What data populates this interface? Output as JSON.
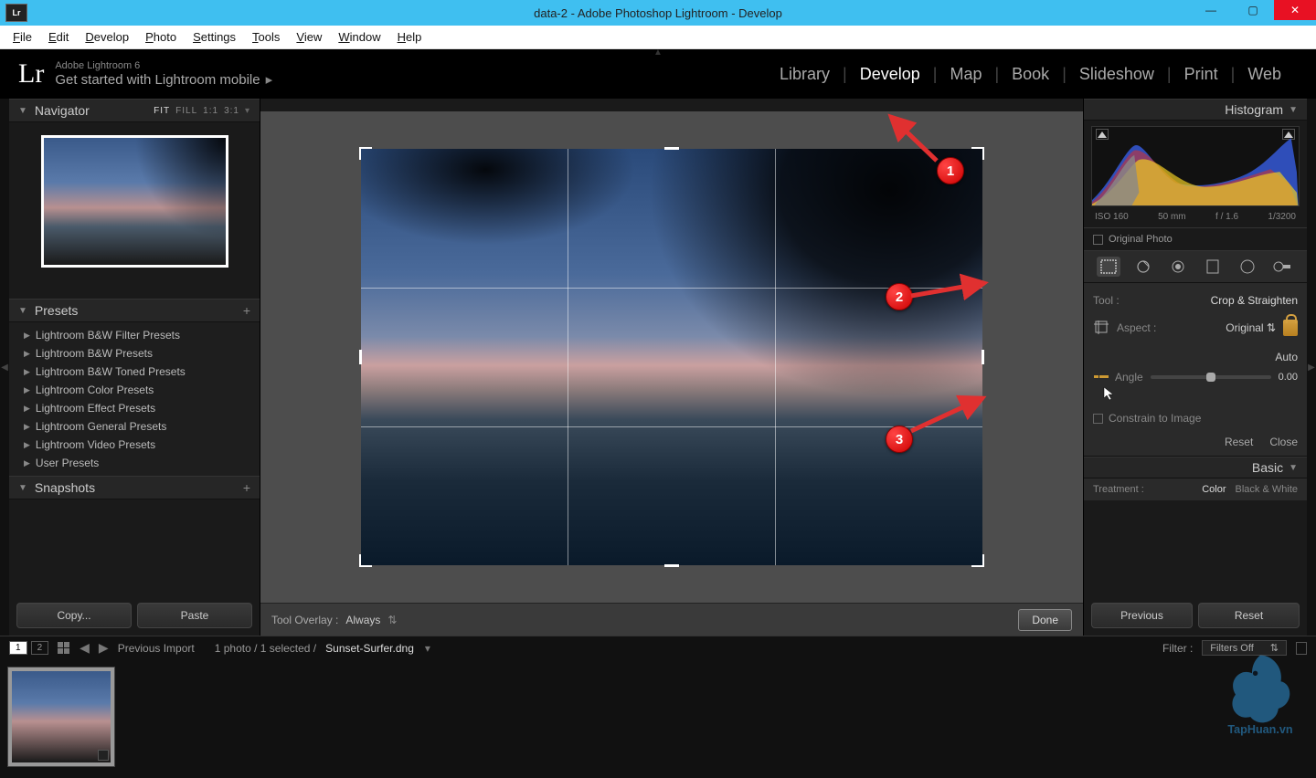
{
  "window": {
    "title": "data-2 - Adobe Photoshop Lightroom - Develop",
    "app_icon_text": "Lr"
  },
  "menu": {
    "items": [
      "File",
      "Edit",
      "Develop",
      "Photo",
      "Settings",
      "Tools",
      "View",
      "Window",
      "Help"
    ]
  },
  "identity": {
    "logo": "Lr",
    "line1": "Adobe Lightroom 6",
    "line2": "Get started with Lightroom mobile"
  },
  "modules": [
    "Library",
    "Develop",
    "Map",
    "Book",
    "Slideshow",
    "Print",
    "Web"
  ],
  "active_module": "Develop",
  "navigator": {
    "title": "Navigator",
    "zoom_options": [
      "FIT",
      "FILL",
      "1:1",
      "3:1"
    ],
    "active_zoom": "FIT"
  },
  "presets": {
    "title": "Presets",
    "items": [
      "Lightroom B&W Filter Presets",
      "Lightroom B&W Presets",
      "Lightroom B&W Toned Presets",
      "Lightroom Color Presets",
      "Lightroom Effect Presets",
      "Lightroom General Presets",
      "Lightroom Video Presets",
      "User Presets"
    ]
  },
  "snapshots": {
    "title": "Snapshots"
  },
  "left_buttons": {
    "copy": "Copy...",
    "paste": "Paste"
  },
  "center": {
    "tool_overlay_label": "Tool Overlay :",
    "tool_overlay_value": "Always",
    "done": "Done"
  },
  "histogram": {
    "title": "Histogram",
    "iso": "ISO 160",
    "focal": "50 mm",
    "aperture": "f / 1.6",
    "shutter": "1/3200",
    "original_photo": "Original Photo"
  },
  "crop_tool": {
    "tool_label": "Tool :",
    "tool_name": "Crop & Straighten",
    "aspect_label": "Aspect :",
    "aspect_value": "Original",
    "auto": "Auto",
    "angle_label": "Angle",
    "angle_value": "0.00",
    "constrain": "Constrain to Image",
    "reset": "Reset",
    "close": "Close"
  },
  "basic": {
    "title": "Basic",
    "treatment_label": "Treatment :",
    "treat_color": "Color",
    "treat_bw": "Black & White"
  },
  "right_buttons": {
    "previous": "Previous",
    "reset": "Reset"
  },
  "filmstrip": {
    "source_label": "Previous Import",
    "count_text": "1 photo / 1 selected /",
    "filename": "Sunset-Surfer.dng",
    "filter_label": "Filter :",
    "filter_value": "Filters Off",
    "view_primary": "1",
    "view_secondary": "2"
  },
  "callouts": {
    "1": "1",
    "2": "2",
    "3": "3"
  },
  "watermark": "TapHuan.vn"
}
